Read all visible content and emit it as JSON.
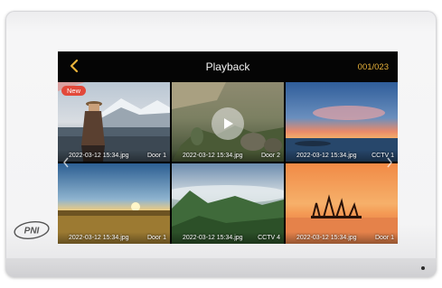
{
  "device": {
    "logo_text": "PNI"
  },
  "header": {
    "title": "Playback",
    "counter": "001/023",
    "back_icon": "chevron-left-icon",
    "accent": "#e8b23a"
  },
  "gallery": {
    "items": [
      {
        "filename": "2022-03-12 15:34.jpg",
        "camera": "Door 1",
        "badge": "New",
        "scene": "woman-by-mountain-lake"
      },
      {
        "filename": "2022-03-12 15:34.jpg",
        "camera": "Door 2",
        "scene": "rocky-cliffs-video",
        "video": true
      },
      {
        "filename": "2022-03-12 15:34.jpg",
        "camera": "CCTV 1",
        "scene": "sunset-over-sea"
      },
      {
        "filename": "2022-03-12 15:34.jpg",
        "camera": "Door 1",
        "scene": "sunset-over-field"
      },
      {
        "filename": "2022-03-12 15:34.jpg",
        "camera": "CCTV 4",
        "scene": "misty-green-valley"
      },
      {
        "filename": "2022-03-12 15:34.jpg",
        "camera": "Door 1",
        "scene": "orange-lake-sunset"
      }
    ]
  },
  "navigation": {
    "prev_icon": "chevron-left-icon",
    "next_icon": "chevron-right-icon"
  },
  "colors": {
    "badge": "#e2493b",
    "screen_bg": "#000000"
  }
}
